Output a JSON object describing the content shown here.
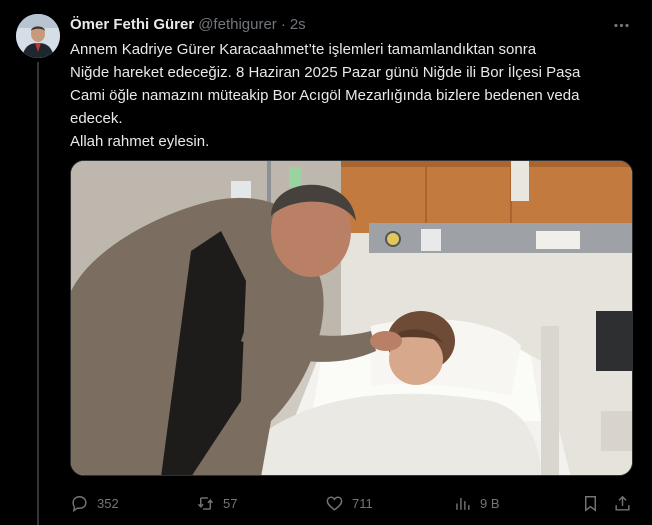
{
  "tweet": {
    "author_name": "Ömer Fethi Gürer",
    "author_handle": "@fethigurer",
    "separator": "·",
    "timestamp": "2s",
    "more_icon": "more-horizontal-icon",
    "text_lines": [
      "Annem Kadriye Gürer Karacaahmet’te  işlemleri tamamlandıktan sonra",
      "Niğde hareket edeceğiz. 8 Haziran 2025 Pazar günü Niğde ili Bor İlçesi Paşa",
      "Cami öğle namazını müteakip Bor Acıgöl Mezarlığında bizlere bedenen veda",
      "edecek.",
      "Allah  rahmet eylesin."
    ]
  },
  "actions": {
    "replies": {
      "icon": "reply-icon",
      "count": "352"
    },
    "reposts": {
      "icon": "repost-icon",
      "count": "57"
    },
    "likes": {
      "icon": "like-icon",
      "count": "711"
    },
    "views": {
      "icon": "views-icon",
      "count": "9 B"
    },
    "bookmark": {
      "icon": "bookmark-icon"
    },
    "share": {
      "icon": "share-icon"
    }
  },
  "colors": {
    "background": "#000000",
    "text_primary": "#e7e9ea",
    "text_secondary": "#71767b",
    "border": "#2f3336"
  }
}
